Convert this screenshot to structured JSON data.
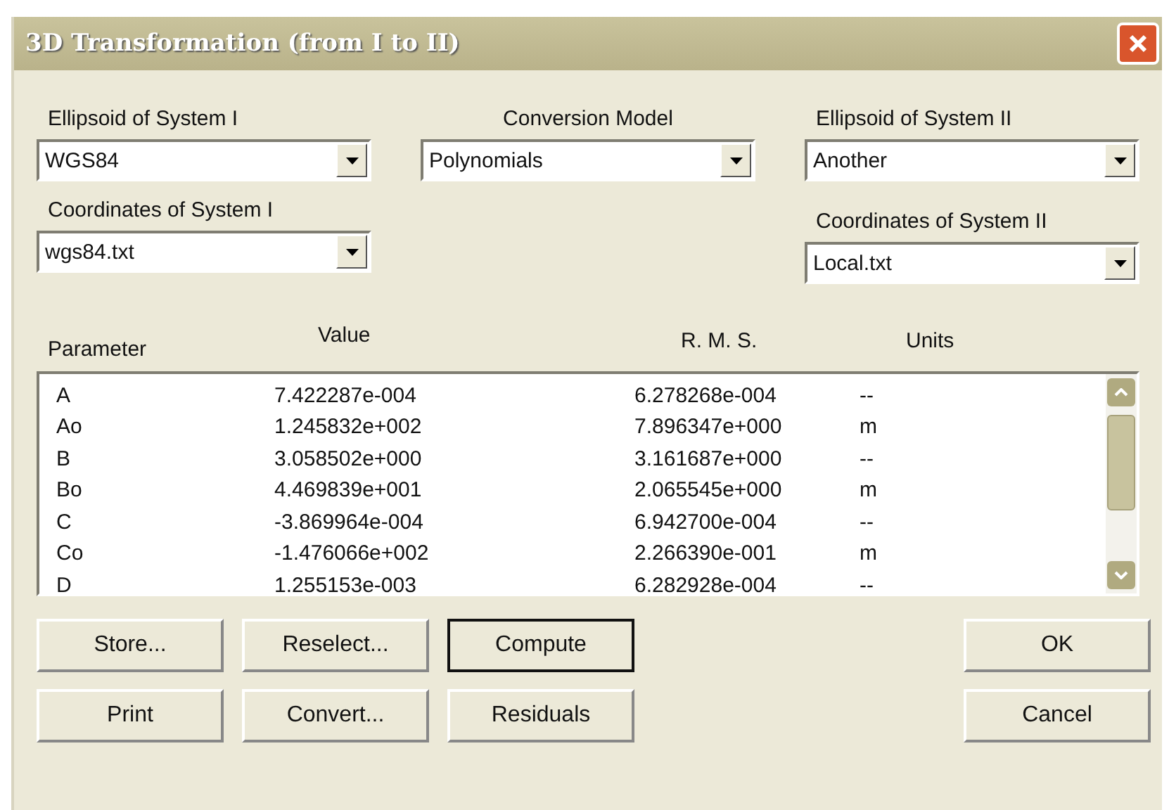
{
  "window": {
    "title": "3D Transformation (from I to II)"
  },
  "ellipsoid_1": {
    "label": "Ellipsoid of System I",
    "value": "WGS84"
  },
  "conversion_model": {
    "label": "Conversion Model",
    "value": "Polynomials"
  },
  "ellipsoid_2": {
    "label": "Ellipsoid of System II",
    "value": "Another"
  },
  "coordinates_1": {
    "label": "Coordinates of System I",
    "value": "wgs84.txt"
  },
  "coordinates_2": {
    "label": "Coordinates of System II",
    "value": "Local.txt"
  },
  "table": {
    "columns": [
      "Parameter",
      "Value",
      "R. M. S.",
      "Units"
    ],
    "rows": [
      [
        "A",
        "7.422287e-004",
        "6.278268e-004",
        "--"
      ],
      [
        "Ao",
        "1.245832e+002",
        "7.896347e+000",
        "m"
      ],
      [
        "B",
        "3.058502e+000",
        "3.161687e+000",
        "--"
      ],
      [
        "Bo",
        "4.469839e+001",
        "2.065545e+000",
        "m"
      ],
      [
        "C",
        "-3.869964e-004",
        "6.942700e-004",
        "--"
      ],
      [
        "Co",
        "-1.476066e+002",
        "2.266390e-001",
        "m"
      ],
      [
        "D",
        "1.255153e-003",
        "6.282928e-004",
        "--"
      ]
    ]
  },
  "buttons_left": [
    [
      {
        "label": "Store...",
        "default": false
      },
      {
        "label": "Reselect...",
        "default": false
      },
      {
        "label": "Compute",
        "default": true
      }
    ],
    [
      {
        "label": "Print",
        "default": false
      },
      {
        "label": "Convert...",
        "default": false
      },
      {
        "label": "Residuals",
        "default": false
      }
    ]
  ],
  "buttons_right": [
    {
      "label": "OK",
      "default": false
    },
    {
      "label": "Cancel",
      "default": false
    }
  ]
}
